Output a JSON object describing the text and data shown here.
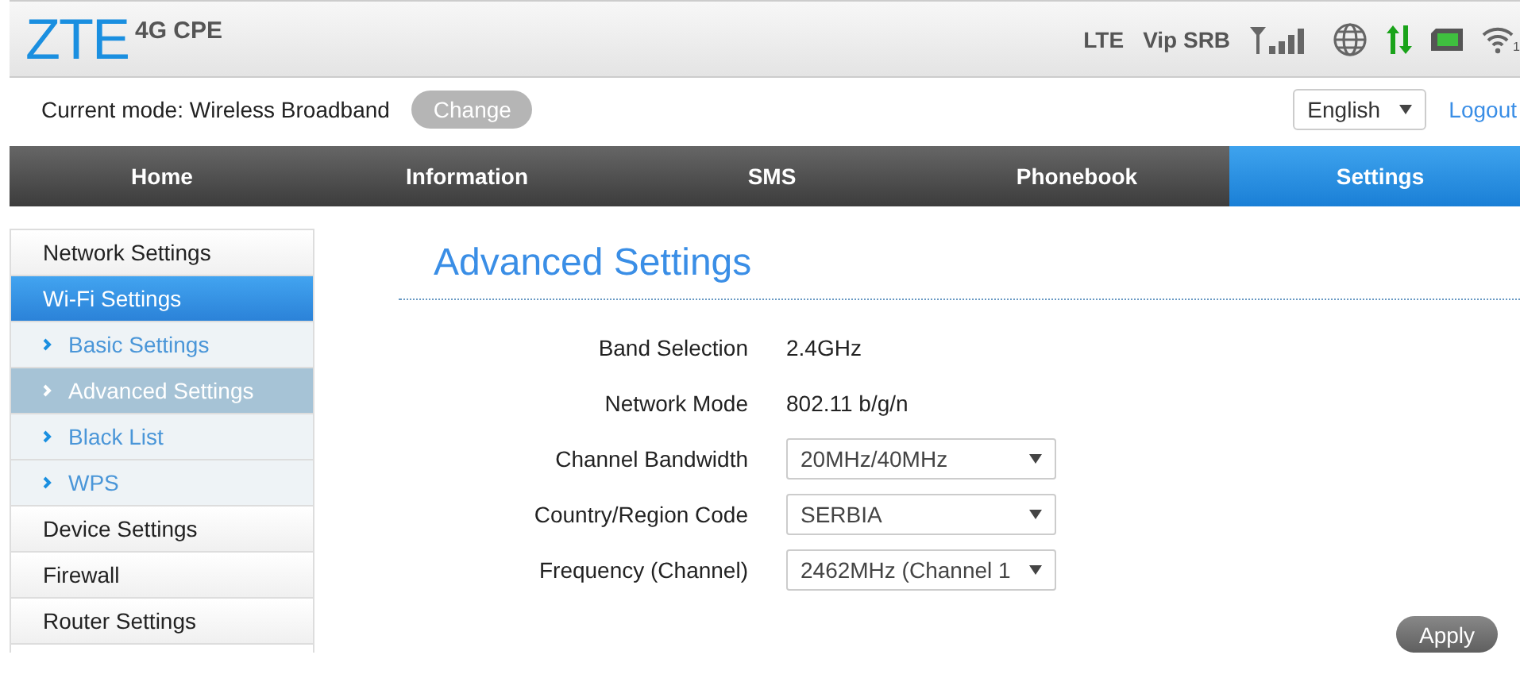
{
  "header": {
    "logo": "ZTE",
    "product": "4G CPE",
    "network_type": "LTE",
    "operator": "Vip SRB",
    "wifi_clients": "1"
  },
  "mode_bar": {
    "label": "Current mode: Wireless Broadband",
    "button": {
      "label": "Change",
      "disabled": true
    },
    "language": "English",
    "logout": "Logout"
  },
  "nav": [
    {
      "label": "Home",
      "selected": false
    },
    {
      "label": "Information",
      "selected": false
    },
    {
      "label": "SMS",
      "selected": false
    },
    {
      "label": "Phonebook",
      "selected": false
    },
    {
      "label": "Settings",
      "selected": true
    }
  ],
  "sidebar": {
    "items": [
      {
        "label": "Network Settings",
        "selected": false
      },
      {
        "label": "Wi-Fi Settings",
        "selected": true,
        "children": [
          {
            "label": "Basic Settings",
            "selected": false
          },
          {
            "label": "Advanced Settings",
            "selected": true
          },
          {
            "label": "Black List",
            "selected": false
          },
          {
            "label": "WPS",
            "selected": false
          }
        ]
      },
      {
        "label": "Device Settings",
        "selected": false
      },
      {
        "label": "Firewall",
        "selected": false
      },
      {
        "label": "Router Settings",
        "selected": false
      }
    ]
  },
  "content": {
    "title": "Advanced Settings",
    "fields": [
      {
        "kind": "text",
        "label": "Band Selection",
        "value": "2.4GHz"
      },
      {
        "kind": "text",
        "label": "Network Mode",
        "value": "802.11 b/g/n"
      },
      {
        "kind": "select",
        "label": "Channel Bandwidth",
        "value": "20MHz/40MHz"
      },
      {
        "kind": "select",
        "label": "Country/Region Code",
        "value": "SERBIA"
      },
      {
        "kind": "select",
        "label": "Frequency (Channel)",
        "value": "2462MHz (Channel 1"
      }
    ],
    "apply": "Apply"
  }
}
